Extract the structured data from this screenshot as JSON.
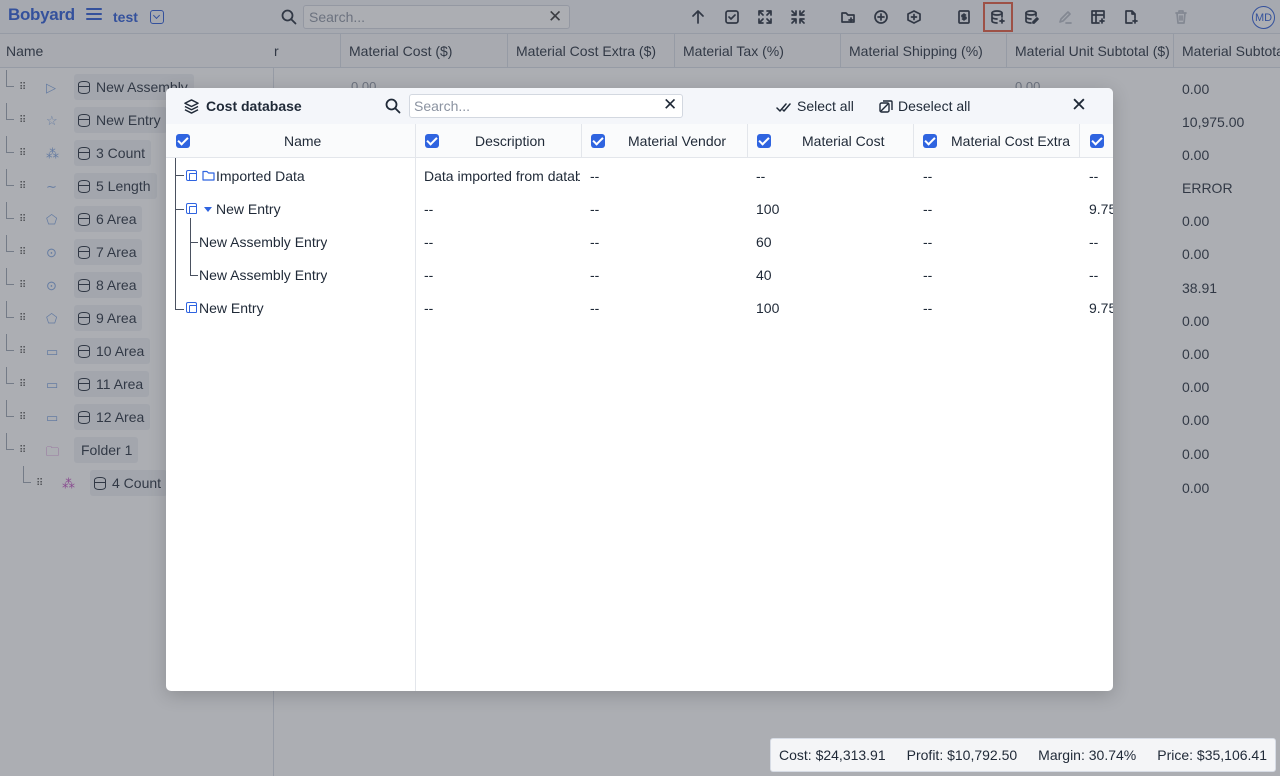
{
  "app": {
    "logo": "Bobyard",
    "project_name": "test",
    "search_placeholder": "Search...",
    "avatar_initials": "MD"
  },
  "toolbar": {
    "icons": [
      "arrow-up-icon",
      "check-square-icon",
      "expand-icon",
      "collapse-icon",
      "folder-add-icon",
      "plus-circle-icon",
      "plus-circle-alt-icon",
      "dollar-file-icon",
      "database-add-icon",
      "database-edit-icon",
      "pencil-icon",
      "table-add-icon",
      "file-add-icon",
      "trash-icon"
    ],
    "highlighted": "database-add-icon"
  },
  "background_table": {
    "columns": [
      "Name",
      "r",
      "Material Cost ($)",
      "Material Cost Extra ($)",
      "Material Tax (%)",
      "Material Shipping (%)",
      "Material Unit Subtotal ($)",
      "Material Subtota"
    ],
    "rows": [
      {
        "name": "New Assembly",
        "icon": "play-icon",
        "subtotal": "0.00"
      },
      {
        "name": "New Entry",
        "icon": "star-icon",
        "subtotal": "10,975.00"
      },
      {
        "name": "3 Count",
        "icon": "count-icon",
        "subtotal": "0.00"
      },
      {
        "name": "5 Length",
        "icon": "length-icon",
        "subtotal": "ERROR"
      },
      {
        "name": "6 Area",
        "icon": "polygon-icon",
        "subtotal": "0.00"
      },
      {
        "name": "7 Area",
        "icon": "circle-icon",
        "subtotal": "0.00"
      },
      {
        "name": "8 Area",
        "icon": "circle-icon",
        "subtotal": "38.91"
      },
      {
        "name": "9 Area",
        "icon": "polygon-icon",
        "subtotal": "0.00"
      },
      {
        "name": "10 Area",
        "icon": "rect-icon",
        "subtotal": "0.00"
      },
      {
        "name": "11 Area",
        "icon": "rect-icon",
        "subtotal": "0.00"
      },
      {
        "name": "12 Area",
        "icon": "rect-icon",
        "subtotal": "0.00"
      },
      {
        "name": "Folder 1",
        "icon": "folder-icon",
        "subtotal": "0.00"
      },
      {
        "name": "4 Count",
        "icon": "count-icon",
        "subtotal": "0.00"
      }
    ],
    "faint_values": {
      "material_cost": "0.00",
      "unit_subtotal": "0.00"
    }
  },
  "summary": {
    "cost": "Cost: $24,313.91",
    "profit": "Profit: $10,792.50",
    "margin": "Margin: 30.74%",
    "price": "Price: $35,106.41"
  },
  "modal": {
    "title": "Cost database",
    "search_placeholder": "Search...",
    "select_all": "Select all",
    "deselect_all": "Deselect all",
    "columns": [
      "Name",
      "Description",
      "Material Vendor",
      "Material Cost",
      "Material Cost Extra",
      ""
    ],
    "rows": [
      {
        "name": "Imported Data",
        "description": "Data imported from datab",
        "vendor": "--",
        "cost": "--",
        "cost_extra": "--",
        "next": "--"
      },
      {
        "name": "New Entry",
        "description": "--",
        "vendor": "--",
        "cost": "100",
        "cost_extra": "--",
        "next": "9.75"
      },
      {
        "name": "New Assembly Entry",
        "description": "--",
        "vendor": "--",
        "cost": "60",
        "cost_extra": "--",
        "next": "--"
      },
      {
        "name": "New Assembly Entry",
        "description": "--",
        "vendor": "--",
        "cost": "40",
        "cost_extra": "--",
        "next": "--"
      },
      {
        "name": "New Entry",
        "description": "--",
        "vendor": "--",
        "cost": "100",
        "cost_extra": "--",
        "next": "9.75"
      }
    ]
  },
  "colors": {
    "accent": "#2557d6",
    "checkbox": "#2f64e0",
    "highlight": "#e4573a"
  }
}
